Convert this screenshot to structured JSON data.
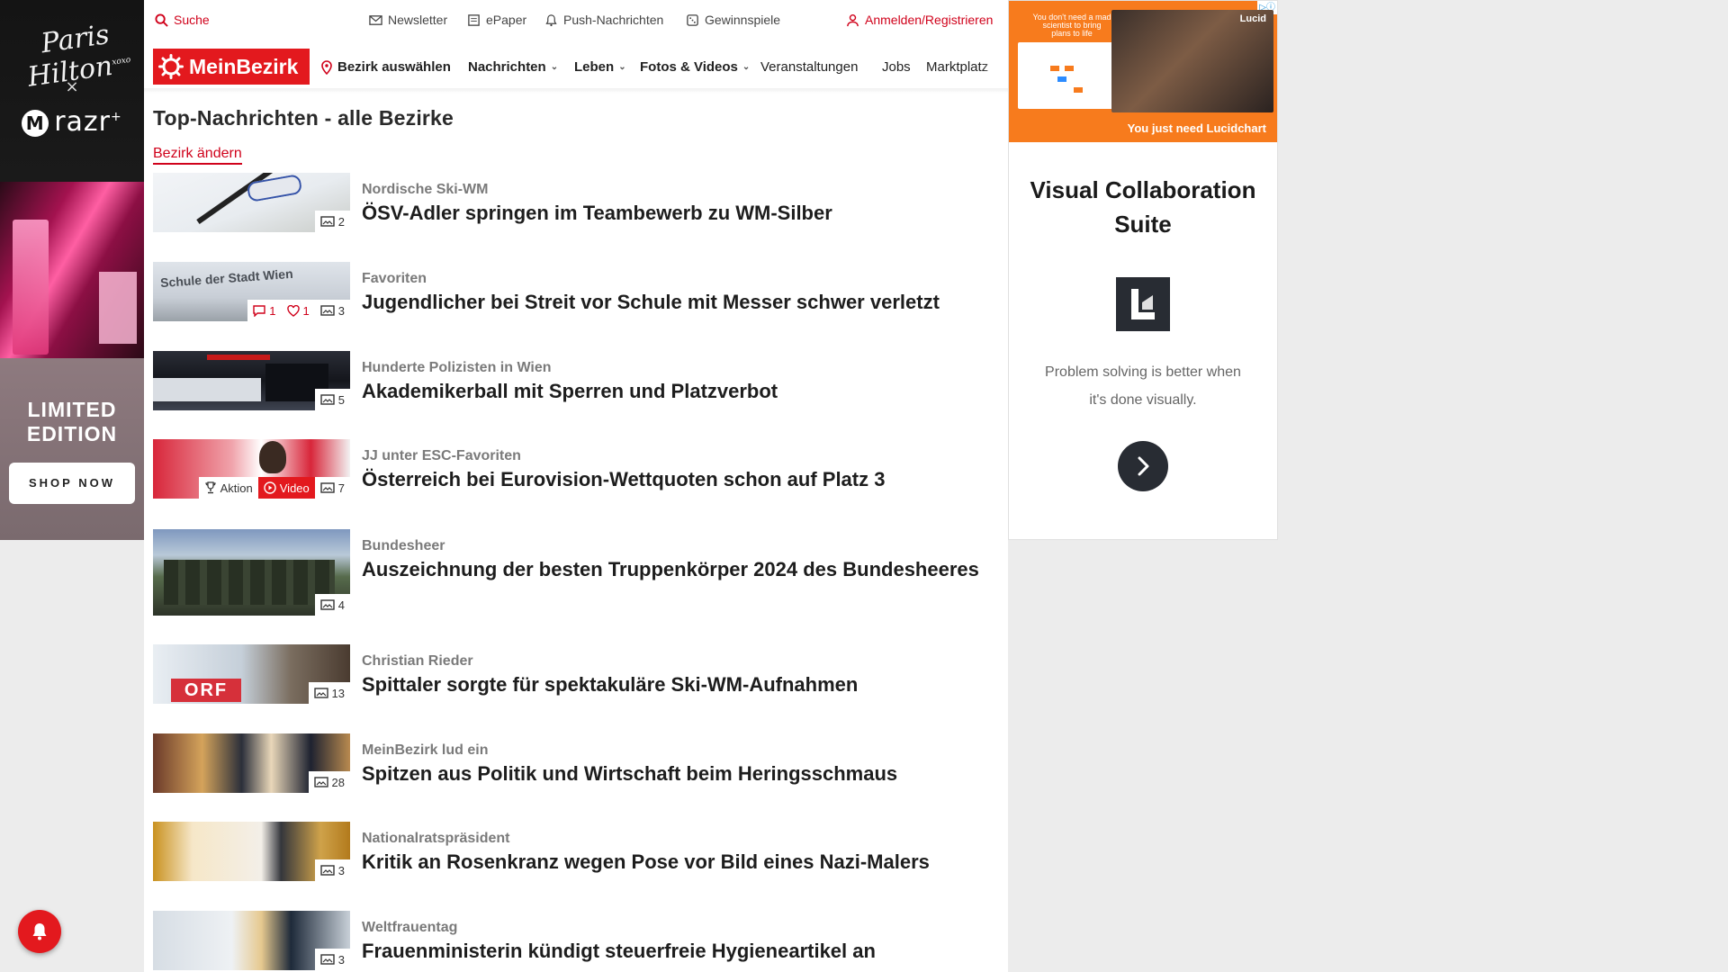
{
  "left_ad": {
    "brand_script": "Paris Hilton",
    "brand_script_small": "xoxo",
    "x": "×",
    "partner": "razr",
    "partner_sup": "+",
    "limited": "LIMITED",
    "edition": "EDITION",
    "cta": "SHOP NOW"
  },
  "topbar": {
    "search": "Suche",
    "newsletter": "Newsletter",
    "epaper": "ePaper",
    "push": "Push-Nachrichten",
    "gewinnspiele": "Gewinnspiele",
    "login": "Anmelden/Registrieren"
  },
  "nav": {
    "logo": "MeinBezirk",
    "bezirk": "Bezirk auswählen",
    "items": [
      {
        "label": "Nachrichten",
        "dropdown": true
      },
      {
        "label": "Leben",
        "dropdown": true
      },
      {
        "label": "Fotos & Videos",
        "dropdown": true
      },
      {
        "label": "Veranstaltungen",
        "dropdown": false
      },
      {
        "label": "Jobs",
        "dropdown": false
      },
      {
        "label": "Marktplatz",
        "dropdown": false
      }
    ]
  },
  "page": {
    "title": "Top-Nachrichten - alle Bezirke",
    "change_district": "Bezirk ändern"
  },
  "articles": [
    {
      "kicker": "Nordische Ski-WM",
      "headline": "ÖSV-Adler springen im Teambewerb zu WM-Silber",
      "photos": "2"
    },
    {
      "kicker": "Favoriten",
      "headline": "Jugendlicher bei Streit vor Schule mit Messer schwer verletzt",
      "comments": "1",
      "likes": "1",
      "photos": "3",
      "thumb_text": "Schule der Stadt Wien"
    },
    {
      "kicker": "Hunderte Polizisten in Wien",
      "headline": "Akademikerball mit Sperren und Platzverbot",
      "photos": "5"
    },
    {
      "kicker": "JJ unter ESC-Favoriten",
      "headline": "Österreich bei Eurovision-Wettquoten schon auf Platz 3",
      "aktion": "Aktion",
      "video": "Video",
      "photos": "7"
    },
    {
      "kicker": "Bundesheer",
      "headline": "Auszeichnung der besten Truppenkörper 2024 des Bundesheeres",
      "photos": "4"
    },
    {
      "kicker": "Christian Rieder",
      "headline": "Spittaler sorgte für spektakuläre Ski-WM-Aufnahmen",
      "photos": "13",
      "thumb_text": "ORF"
    },
    {
      "kicker": "MeinBezirk lud ein",
      "headline": "Spitzen aus Politik und Wirtschaft beim Heringsschmaus",
      "photos": "28"
    },
    {
      "kicker": "Nationalratspräsident",
      "headline": "Kritik an Rosenkranz wegen Pose vor Bild eines Nazi-Malers",
      "photos": "3"
    },
    {
      "kicker": "Weltfrauentag",
      "headline": "Frauenministerin kündigt steuerfreie Hygieneartikel an",
      "photos": "3"
    }
  ],
  "right_ad": {
    "banner_small": "You don't need a mad scientist to bring plans to life",
    "banner_brand": "Lucid",
    "banner_cta": "You just need Lucidchart",
    "title_line1": "Visual Collaboration",
    "title_line2": "Suite",
    "tagline": "Problem solving is better when it's done visually."
  },
  "colors": {
    "brand_red": "#e3191e",
    "link_red": "#d0021b",
    "lucid_orange": "#f77b1d",
    "lucid_dark": "#282c33"
  }
}
